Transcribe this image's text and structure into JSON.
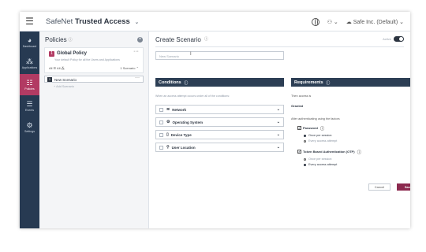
{
  "topbar": {
    "menu_icon": "hamburger-icon",
    "brand_light": "SafeNet",
    "brand_bold": "Trusted Access",
    "brand_chevron": "⌄",
    "user_label": "Safe Inc. (Default)"
  },
  "sidebar": {
    "items": [
      {
        "icon": "dashboard-icon",
        "glyph": "◕",
        "label": "Dashboard"
      },
      {
        "icon": "applications-icon",
        "glyph": "⁂",
        "label": "Applications"
      },
      {
        "icon": "policies-icon",
        "glyph": "☷",
        "label": "Policies"
      },
      {
        "icon": "events-icon",
        "glyph": "☰",
        "label": "Events"
      },
      {
        "icon": "settings-icon",
        "glyph": "⚙",
        "label": "Settings"
      }
    ],
    "active_index": 2
  },
  "policies": {
    "title": "Policies",
    "info": "ⓘ",
    "add_glyph": "+",
    "global": {
      "number": "1",
      "title": "Global Policy",
      "description": "Your default Policy for all the Users and Applications",
      "menu": "···",
      "filters": "All ☰  All ⁂",
      "count": "1 Scenario ⌃"
    },
    "new_scenario": {
      "number": "1",
      "title": "New Scenario",
      "menu": "···"
    },
    "add_scenario": "+ Add Scenario"
  },
  "main": {
    "title": "Create Scenario",
    "info": "ⓘ",
    "active_label": "Active",
    "name_placeholder": "New Scenario",
    "cursor": "I",
    "conditions": {
      "header": "Conditions",
      "info": "ⓘ",
      "description": "When an access attempt occurs under all of the conditions:",
      "rows": [
        {
          "label": "Network",
          "icon": "wifi-icon",
          "glyph": "≋"
        },
        {
          "label": "Operating System",
          "icon": "gear-icon",
          "glyph": "⚙"
        },
        {
          "label": "Device Type",
          "icon": "device-icon",
          "glyph": "▯"
        },
        {
          "label": "User Location",
          "icon": "location-pin-icon",
          "glyph": "⚲"
        }
      ],
      "chevron": "⌄"
    },
    "requirements": {
      "header": "Requirements",
      "info": "ⓘ",
      "access_label": "Then access is",
      "access_value": "Granted",
      "after_label": "After authenticating using the factors",
      "password": {
        "label": "Password",
        "checked_glyph": "✓",
        "options": [
          "Once per session",
          "Every access attempt"
        ],
        "selected": 0
      },
      "token": {
        "label": "Token Based Authentication (OTP)",
        "checked_glyph": "✓",
        "options": [
          "Once per session",
          "Every access attempt"
        ],
        "selected": 1
      }
    },
    "cancel_label": "Cancel",
    "save_label": "Save"
  },
  "colors": {
    "accent": "#b23b63",
    "sidebar": "#273a52",
    "header_bar": "#2c3e54",
    "save": "#8c2a4f"
  }
}
